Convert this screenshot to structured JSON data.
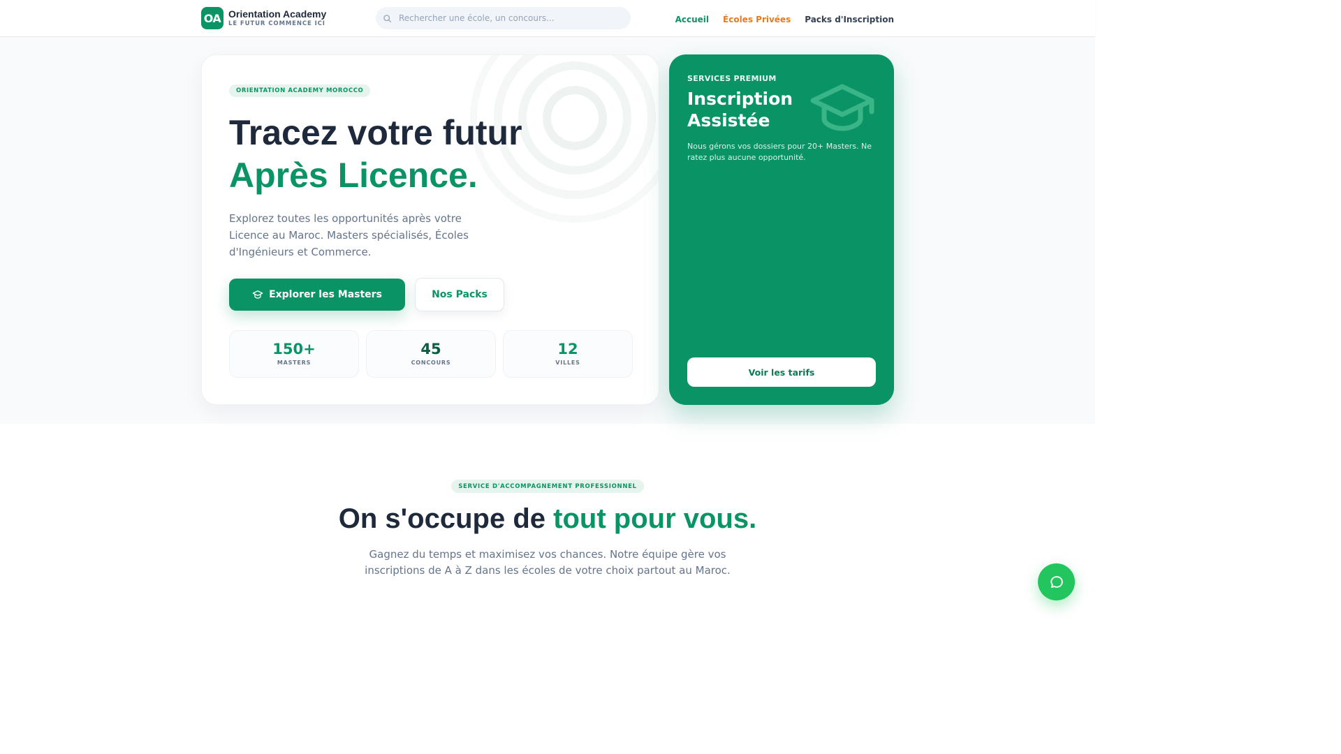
{
  "header": {
    "logo_initials": "OA",
    "logo_name": "Orientation Academy",
    "logo_tagline": "LE FUTUR COMMENCE ICI",
    "search_placeholder": "Rechercher une école, un concours...",
    "nav": {
      "home": "Accueil",
      "private_schools": "Écoles Privées",
      "packs": "Packs d'Inscription"
    }
  },
  "hero": {
    "pill": "ORIENTATION ACADEMY MOROCCO",
    "title_line1": "Tracez votre futur",
    "title_line2": "Après Licence.",
    "description": "Explorez toutes les opportunités après votre Licence au Maroc. Masters spécialisés, Écoles d'Ingénieurs et Commerce.",
    "primary_button": "Explorer les Masters",
    "secondary_button": "Nos Packs",
    "stats": [
      {
        "value": "150+",
        "label": "MASTERS",
        "color": "#0a9466"
      },
      {
        "value": "45",
        "label": "CONCOURS",
        "color": "#0f5c44"
      },
      {
        "value": "12",
        "label": "VILLES",
        "color": "#0a9466"
      }
    ]
  },
  "premium": {
    "label": "SERVICES PREMIUM",
    "title": "Inscription Assistée",
    "description": "Nous gérons vos dossiers pour 20+ Masters. Ne ratez plus aucune opportunité.",
    "button": "Voir les tarifs",
    "icon": "graduation-cap-icon"
  },
  "services": {
    "pill": "SERVICE D'ACCOMPAGNEMENT PROFESSIONNEL",
    "title_start": "On s'occupe de ",
    "title_accent": "tout pour vous.",
    "description": "Gagnez du temps et maximisez vos chances. Notre équipe gère vos inscriptions de A à Z dans les écoles de votre choix partout au Maroc."
  },
  "chat_button": {
    "icon": "chat-bubble-icon"
  },
  "colors": {
    "brand_green": "#0a9466",
    "accent_orange": "#ea7a17",
    "text_dark": "#1e293b",
    "chat_green": "#22c55e"
  }
}
